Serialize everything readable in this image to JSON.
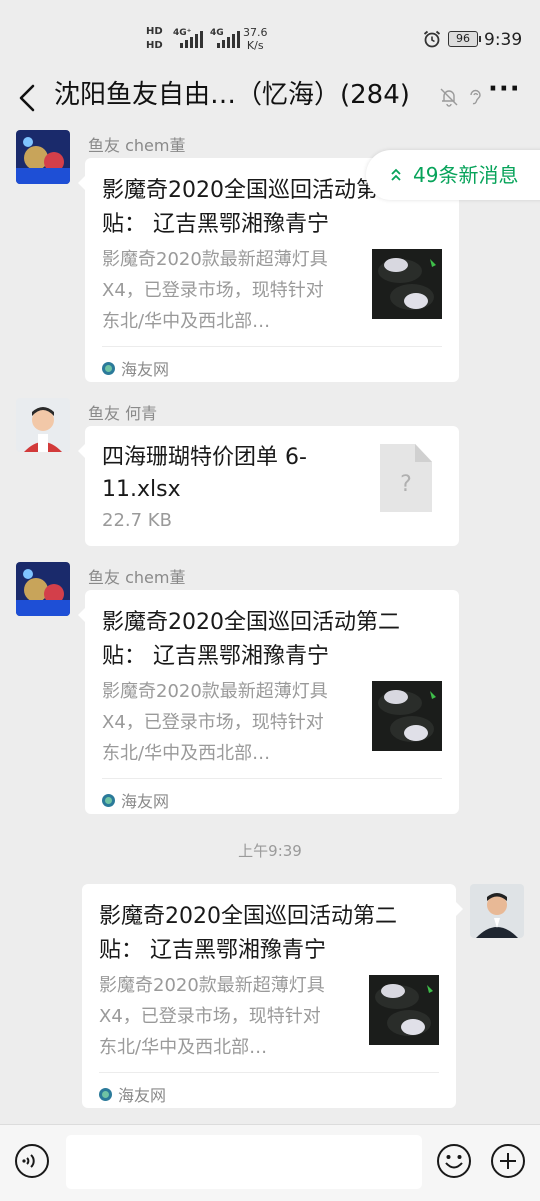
{
  "status_bar": {
    "hd1": "HD",
    "hd2": "HD",
    "net1": "4G⁺",
    "net2": "4G",
    "speed_value": "37.6",
    "speed_unit": "K/s",
    "battery": "96",
    "time": "9:39"
  },
  "header": {
    "title": "沈阳鱼友自由…（忆海）(284)",
    "more": "···"
  },
  "new_messages_label": "49条新消息",
  "messages": [
    {
      "sender": "鱼友 chem董",
      "title": "影魔奇2020全国巡回活动第二贴： 辽吉黑鄂湘豫青宁",
      "description": "影魔奇2020款最新超薄灯具X4，已登录市场，现特针对东北/华中及西北部…",
      "source": "海友网"
    },
    {
      "sender": "鱼友 何青",
      "file_name": "四海珊瑚特价团单 6-11.xlsx",
      "file_size": "22.7 KB",
      "file_icon": "?"
    },
    {
      "sender": "鱼友 chem董",
      "title": "影魔奇2020全国巡回活动第二贴： 辽吉黑鄂湘豫青宁",
      "description": "影魔奇2020款最新超薄灯具X4，已登录市场，现特针对东北/华中及西北部…",
      "source": "海友网"
    },
    {
      "title": "影魔奇2020全国巡回活动第二贴： 辽吉黑鄂湘豫青宁",
      "description": "影魔奇2020款最新超薄灯具X4，已登录市场，现特针对东北/华中及西北部…",
      "source": "海友网"
    }
  ],
  "timestamp": "上午9:39",
  "input": {
    "placeholder": ""
  },
  "colors": {
    "accent_green": "#07a35a",
    "background": "#ededed"
  }
}
